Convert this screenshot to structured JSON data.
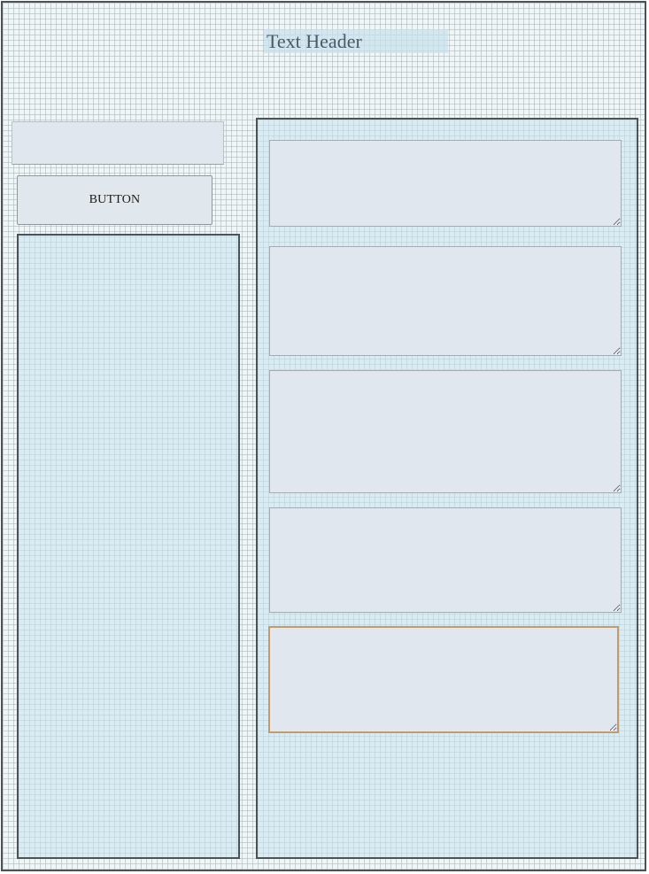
{
  "header": {
    "title": "Text Header"
  },
  "top_input": {
    "value": "",
    "placeholder": ""
  },
  "button": {
    "label": "BUTTON"
  },
  "textareas": [
    {
      "value": ""
    },
    {
      "value": ""
    },
    {
      "value": ""
    },
    {
      "value": ""
    },
    {
      "value": "",
      "focused": true
    }
  ],
  "colors": {
    "frame_border": "#4a5358",
    "panel_fill": "#d4e9f2",
    "field_fill": "#e1e7ee",
    "focus_border": "#c49a6c",
    "header_text": "#4a5a66"
  }
}
